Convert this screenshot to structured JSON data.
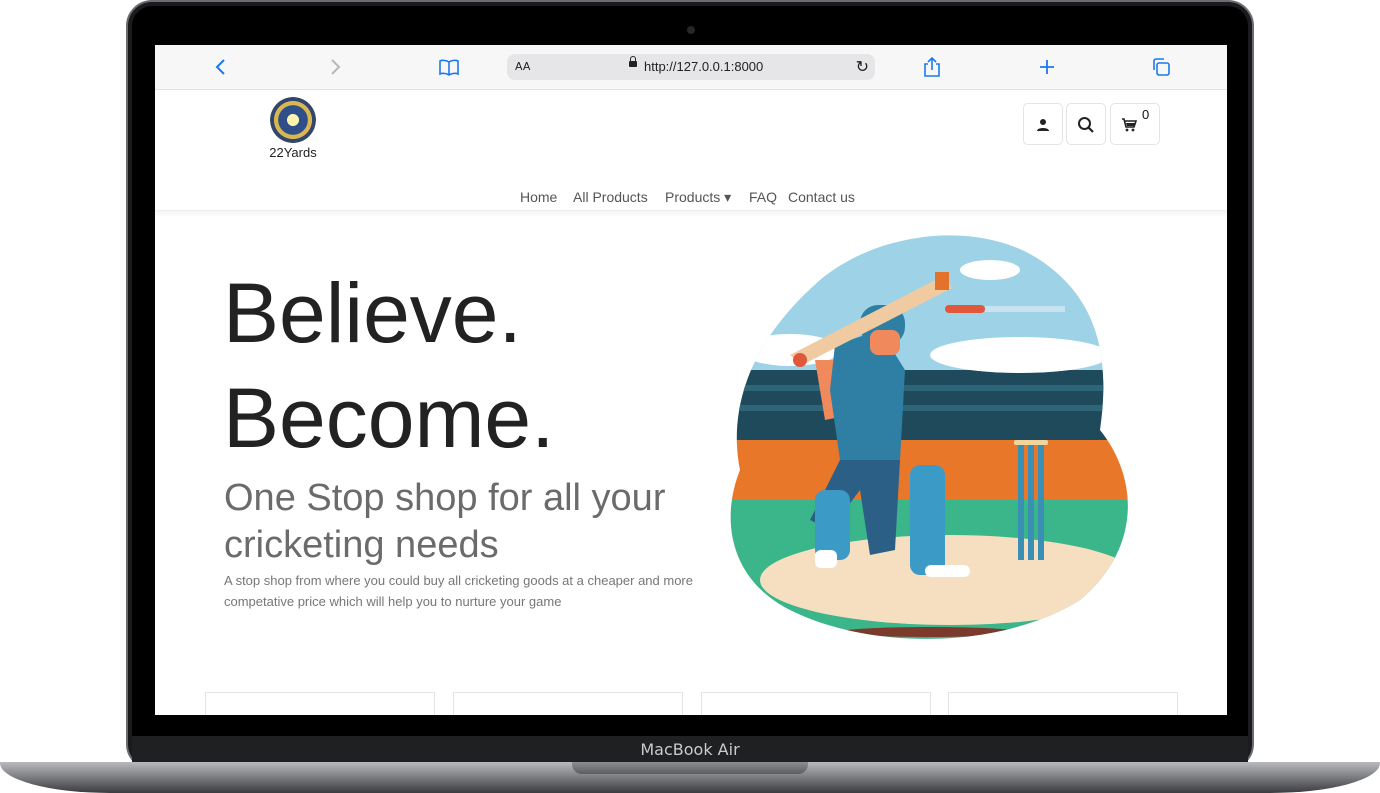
{
  "device": {
    "label": "MacBook Air"
  },
  "browser": {
    "back_icon": "chevron-left-icon",
    "forward_icon": "chevron-right-icon",
    "bookmarks_icon": "book-icon",
    "text_size_label": "AA",
    "url": "http://127.0.0.1:8000",
    "share_icon": "share-icon",
    "new_tab_icon": "plus-icon",
    "tabs_icon": "tabs-icon"
  },
  "site": {
    "brand": "22Yards",
    "cart_count": "0",
    "nav": [
      {
        "label": "Home"
      },
      {
        "label": "All Products"
      },
      {
        "label": "Products ▾"
      },
      {
        "label": "FAQ"
      },
      {
        "label": "Contact us"
      }
    ]
  },
  "hero": {
    "line1": "Believe.",
    "line2": "Become.",
    "subheading": "One Stop shop for all your cricketing needs",
    "description": "A stop shop from where you could buy all cricketing goods at a cheaper and more competative price which will help you to nurture your game"
  },
  "colors": {
    "accent_blue": "#1c78f0",
    "heading": "#222222",
    "subheading": "#6b6b6b"
  }
}
